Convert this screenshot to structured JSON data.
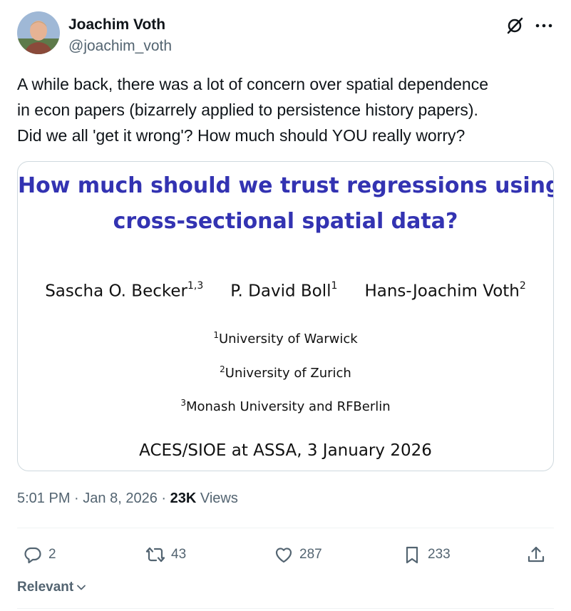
{
  "author": {
    "name": "Joachim Voth",
    "handle": "@joachim_voth"
  },
  "header_icons": [
    "grok-icon",
    "more-icon"
  ],
  "tweet": {
    "lines": [
      "A while back, there was a lot of concern over spatial dependence",
      "in econ papers (bizarrely applied to persistence history papers).",
      "Did we all 'get it wrong'? How much should YOU really worry?"
    ]
  },
  "slide": {
    "title_line1": "How much should we trust regressions using",
    "title_line2": "cross-sectional spatial data?",
    "authors": [
      {
        "name": "Sascha O. Becker",
        "sup": "1,3"
      },
      {
        "name": "P. David Boll",
        "sup": "1"
      },
      {
        "name": "Hans-Joachim Voth",
        "sup": "2"
      }
    ],
    "affiliations": [
      {
        "sup": "1",
        "name": "University of Warwick"
      },
      {
        "sup": "2",
        "name": "University of Zurich"
      },
      {
        "sup": "3",
        "name": "Monash University and RFBerlin"
      }
    ],
    "event": "ACES/SIOE at ASSA, 3 January 2026",
    "title_color": "#3333b2"
  },
  "meta": {
    "time": "5:01 PM",
    "separator": "·",
    "date": "Jan 8, 2026",
    "views_count": "23K",
    "views_label": "Views"
  },
  "actions": {
    "replies": "2",
    "reposts": "43",
    "likes": "287",
    "bookmarks": "233"
  },
  "sort": {
    "label": "Relevant"
  },
  "colors": {
    "text_primary": "#0f1419",
    "text_secondary": "#536471",
    "border": "#cfd9de"
  }
}
